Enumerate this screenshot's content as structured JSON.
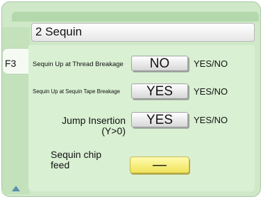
{
  "header": {
    "title": "2 Sequin"
  },
  "tab": {
    "label": "F3"
  },
  "rows": [
    {
      "label": "Sequin Up at Thread Breakage",
      "value": "NO",
      "options": "YES/NO"
    },
    {
      "label": "Sequin Up at Sequin Tape Breakage",
      "value": "YES",
      "options": "YES/NO"
    },
    {
      "label": "Jump Insertion\n(Y>0)",
      "value": "YES",
      "options": "YES/NO"
    },
    {
      "label": "Sequin chip\nfeed",
      "value": "—"
    }
  ]
}
